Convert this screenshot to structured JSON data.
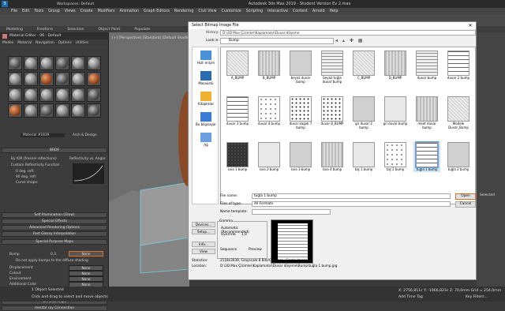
{
  "app": {
    "title": "Autodesk 3ds Max 2019 - Student Version   Ev 2.max",
    "tab": "Workspaces: Default",
    "menu": [
      "File",
      "Edit",
      "Tools",
      "Group",
      "Views",
      "Create",
      "Modifiers",
      "Animation",
      "Graph Editors",
      "Rendering",
      "Civil View",
      "Customize",
      "Scripting",
      "Interactive",
      "Content",
      "Arnold",
      "Help"
    ],
    "ribbon_tabs": [
      "Modeling",
      "Freeform",
      "Selection",
      "Object Paint",
      "Populate"
    ],
    "status1": "1 Object Selected",
    "status2": "Click and drag to select and move objects",
    "coords": "X: 2756,811c   Y: -1966,823c   Z: 70,0mm   Grid = 254,0mm",
    "selected": "Selected",
    "add_time_tag": "Add Time Tag",
    "key_filters": "Key Filters..."
  },
  "mated": {
    "title": "Material Editor - 06 - Default",
    "menu": [
      "Modes",
      "Material",
      "Navigation",
      "Options",
      "Utilities"
    ],
    "material_name": "Material #1839",
    "material_type": "Arch & Design",
    "brdf": "BRDF",
    "brdf_opts": [
      "By IOR (fresnel reflections)",
      "Custom Reflectivity Function"
    ],
    "brdf_labels": [
      "0 deg. refl:",
      "90 deg. refl:",
      "Curve shape:"
    ],
    "reflectivity": "Reflectivity vs. Angle:",
    "rollouts": [
      "Self Illumination (Glow)",
      "Special Effects",
      "Advanced Rendering Options",
      "Fast Glossy Interpolation",
      "Special Purpose Maps"
    ],
    "bump_label": "Bump",
    "bump_value": "0,3",
    "none": "None",
    "no_bump_note": "Do not apply bumps to the diffuse shading",
    "maps": [
      "Displacement",
      "Cutout",
      "Environment",
      "Additional Color",
      "Self Illumination Color"
    ],
    "bottom_rollouts": [
      "General Maps",
      "mental ray Connection"
    ]
  },
  "dlg": {
    "title": "Select Bitmap Image File",
    "history_label": "History:",
    "history_value": "D:\\3D Max Çizimler\\Kaplamalar\\Duvar döşeme",
    "lookin_label": "Look in:",
    "lookin_value": "Bump",
    "places": [
      "Hızlı erişim",
      "Masaüstü",
      "Kitaplıklar",
      "Bu bilgisayar",
      "Ağ"
    ],
    "files": [
      "A_BUMP",
      "B_BUMP",
      "beyaz duvar bump",
      "beyaz tuğla duvar bump",
      "C_BUMP",
      "D_BUMP",
      "duvar bump",
      "duvar 2 bump",
      "duvar 3 bump",
      "duvar 4 bump",
      "duvar kağıdı 7 bump",
      "duvar 8_BUMP",
      "gri duvar 2 bump",
      "gri duvar bump",
      "meet duvar bump",
      "Modele Duvar_Bump",
      "sıva 1 bump",
      "sıva 2 bump",
      "sıva 3 bump",
      "sıva 4 bump",
      "taş 1 bump",
      "taş 2 bump",
      "tuğla 1 bump",
      "tuğla 2 bump"
    ],
    "file_name_label": "File name:",
    "file_name_value": "tuğla 1 bump",
    "file_type_label": "Files of type:",
    "file_type_value": "All Formats",
    "name_template_label": "Name template:",
    "open": "Open",
    "cancel": "Cancel",
    "devices": "Devices...",
    "setup": "Setup...",
    "info": "Info...",
    "view": "View",
    "gamma": "Gamma",
    "gamma_opts": [
      "Use image's own gamma",
      "Use system default gamma",
      "Override"
    ],
    "override_value": "1,0",
    "automatic": "Automatic (Recommended)",
    "sequence": "Sequence",
    "preview": "Preview",
    "stats_label": "Statistics:",
    "stats_value": "2118x3039, Grayscale 8 Bits/Channel - Single Image",
    "location_label": "Location:",
    "location_value": "D:\\3D Max Çizimler\\Kaplamalar\\Duvar döşeme\\Bump\\tuğla 1 bump.jpg"
  }
}
